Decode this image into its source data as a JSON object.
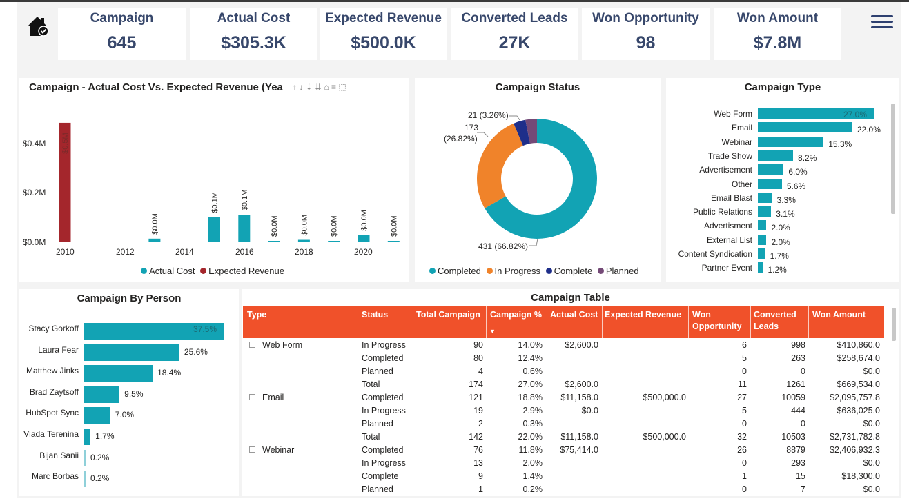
{
  "kpis": [
    {
      "label": "Campaign",
      "value": "645"
    },
    {
      "label": "Actual Cost",
      "value": "$305.3K"
    },
    {
      "label": "Expected Revenue",
      "value": "$500.0K"
    },
    {
      "label": "Converted Leads",
      "value": "27K"
    },
    {
      "label": "Won Opportunity",
      "value": "98"
    },
    {
      "label": "Won Amount",
      "value": "$7.8M"
    }
  ],
  "icons": {
    "home": "home-check-icon",
    "menu": "hamburger-menu-icon",
    "colors": {
      "teal": "#12a3b4",
      "red": "#a4262c",
      "orange": "#f0832a",
      "navy": "#1e2e8a",
      "purple": "#744a77",
      "header": "#f0512a",
      "kpi": "#37476b"
    }
  },
  "cost_chart": {
    "title": "Campaign - Actual Cost Vs. Expected Revenue (Yea",
    "toolbar": "↑ ↓ ⇣ ⇊ ⌂ ≡ ⬚",
    "y_ticks": [
      "$0.4M",
      "$0.2M",
      "$0.0M"
    ],
    "x_ticks": [
      "2010",
      "2012",
      "2014",
      "2016",
      "2018",
      "2020"
    ],
    "legend": [
      "Actual Cost",
      "Expected Revenue"
    ]
  },
  "chart_data": [
    {
      "type": "bar",
      "title": "Campaign - Actual Cost Vs. Expected Revenue (Yea",
      "categories": [
        "2010",
        "2011",
        "2012",
        "2013",
        "2014",
        "2015",
        "2016",
        "2017",
        "2018",
        "2019",
        "2020",
        "2021"
      ],
      "series": [
        {
          "name": "Actual Cost",
          "values": [
            0,
            0,
            0,
            0.015,
            0,
            0.105,
            0.115,
            0.005,
            0.01,
            0.003,
            0.03,
            0.002
          ],
          "labels": [
            "",
            "",
            "",
            "$0.0M",
            "",
            "$0.1M",
            "$0.1M",
            "$0.0M",
            "$0.0M",
            "$0.0M",
            "$0.0M",
            "$0.0M"
          ]
        },
        {
          "name": "Expected Revenue",
          "values": [
            0.5,
            0,
            0,
            0,
            0,
            0,
            0,
            0,
            0,
            0,
            0,
            0
          ],
          "labels": [
            "$0.5M",
            "",
            "",
            "",
            "",
            "",
            "",
            "",
            "",
            "",
            "",
            ""
          ]
        }
      ],
      "ylim": [
        0,
        0.52
      ],
      "y_ticks": [
        "$0.0M",
        "$0.2M",
        "$0.4M"
      ]
    },
    {
      "type": "pie",
      "title": "Campaign Status",
      "categories": [
        "Completed",
        "In Progress",
        "Complete",
        "Planned"
      ],
      "values": [
        431,
        173,
        21,
        20
      ],
      "labels": [
        "431 (66.82%)",
        "173\n(26.82%)",
        "21 (3.26%)",
        ""
      ]
    },
    {
      "type": "bar",
      "title": "Campaign Type",
      "categories": [
        "Web Form",
        "Email",
        "Webinar",
        "Trade Show",
        "Advertisement",
        "Other",
        "Email Blast",
        "Public Relations",
        "Advertisment",
        "External List",
        "Content Syndication",
        "Partner Event"
      ],
      "values": [
        27.0,
        22.0,
        15.3,
        8.2,
        6.0,
        5.6,
        3.3,
        3.1,
        2.0,
        2.0,
        1.7,
        1.2
      ],
      "labels": [
        "27.0%",
        "22.0%",
        "15.3%",
        "8.2%",
        "6.0%",
        "5.6%",
        "3.3%",
        "3.1%",
        "2.0%",
        "2.0%",
        "1.7%",
        "1.2%"
      ]
    },
    {
      "type": "bar",
      "title": "Campaign By Person",
      "categories": [
        "Stacy Gorkoff",
        "Laura Fear",
        "Matthew Jinks",
        "Brad Zaytsoff",
        "HubSpot Sync",
        "Vlada Terenina",
        "Bijan Sanii",
        "Marc Borbas"
      ],
      "values": [
        37.5,
        25.6,
        18.4,
        9.5,
        7.0,
        1.7,
        0.2,
        0.2
      ],
      "labels": [
        "37.5%",
        "25.6%",
        "18.4%",
        "9.5%",
        "7.0%",
        "1.7%",
        "0.2%",
        "0.2%"
      ]
    }
  ],
  "status_chart": {
    "title": "Campaign Status",
    "labels": {
      "small": "21 (3.26%)",
      "mid1": "173",
      "mid2": "(26.82%)",
      "big": "431 (66.82%)"
    },
    "legend": [
      "Completed",
      "In Progress",
      "Complete",
      "Planned"
    ]
  },
  "type_chart": {
    "title": "Campaign Type"
  },
  "person_chart": {
    "title": "Campaign By Person"
  },
  "table": {
    "title": "Campaign Table",
    "headers": [
      "Type",
      "Status",
      "Total Campaign",
      "Campaign %",
      "Actual Cost",
      "Expected Revenue",
      "Won",
      "Opportunity",
      "Converted",
      "Leads",
      "Won Amount"
    ],
    "sort_indicator": "▼",
    "rows": [
      {
        "type": "Web Form",
        "status": "In Progress",
        "total": "90",
        "pct": "14.0%",
        "cost": "$2,600.0",
        "rev": "",
        "won": "6",
        "leads": "998",
        "amount": "$410,860.0"
      },
      {
        "type": "",
        "status": "Completed",
        "total": "80",
        "pct": "12.4%",
        "cost": "",
        "rev": "",
        "won": "5",
        "leads": "263",
        "amount": "$258,674.0"
      },
      {
        "type": "",
        "status": "Planned",
        "total": "4",
        "pct": "0.6%",
        "cost": "",
        "rev": "",
        "won": "0",
        "leads": "0",
        "amount": "$0.0"
      },
      {
        "type": "",
        "status": "Total",
        "total": "174",
        "pct": "27.0%",
        "cost": "$2,600.0",
        "rev": "",
        "won": "11",
        "leads": "1261",
        "amount": "$669,534.0"
      },
      {
        "type": "Email",
        "status": "Completed",
        "total": "121",
        "pct": "18.8%",
        "cost": "$11,158.0",
        "rev": "$500,000.0",
        "won": "27",
        "leads": "10059",
        "amount": "$2,095,757.8"
      },
      {
        "type": "",
        "status": "In Progress",
        "total": "19",
        "pct": "2.9%",
        "cost": "$0.0",
        "rev": "",
        "won": "5",
        "leads": "444",
        "amount": "$636,025.0"
      },
      {
        "type": "",
        "status": "Planned",
        "total": "2",
        "pct": "0.3%",
        "cost": "",
        "rev": "",
        "won": "0",
        "leads": "0",
        "amount": "$0.0"
      },
      {
        "type": "",
        "status": "Total",
        "total": "142",
        "pct": "22.0%",
        "cost": "$11,158.0",
        "rev": "$500,000.0",
        "won": "32",
        "leads": "10503",
        "amount": "$2,731,782.8"
      },
      {
        "type": "Webinar",
        "status": "Completed",
        "total": "76",
        "pct": "11.8%",
        "cost": "$75,414.0",
        "rev": "",
        "won": "26",
        "leads": "8879",
        "amount": "$2,406,932.3"
      },
      {
        "type": "",
        "status": "In Progress",
        "total": "13",
        "pct": "2.0%",
        "cost": "",
        "rev": "",
        "won": "0",
        "leads": "293",
        "amount": "$0.0"
      },
      {
        "type": "",
        "status": "Complete",
        "total": "9",
        "pct": "1.4%",
        "cost": "",
        "rev": "",
        "won": "1",
        "leads": "15",
        "amount": "$18,300.0"
      },
      {
        "type": "",
        "status": "Planned",
        "total": "1",
        "pct": "0.2%",
        "cost": "",
        "rev": "",
        "won": "0",
        "leads": "7",
        "amount": "$0.0"
      }
    ]
  }
}
